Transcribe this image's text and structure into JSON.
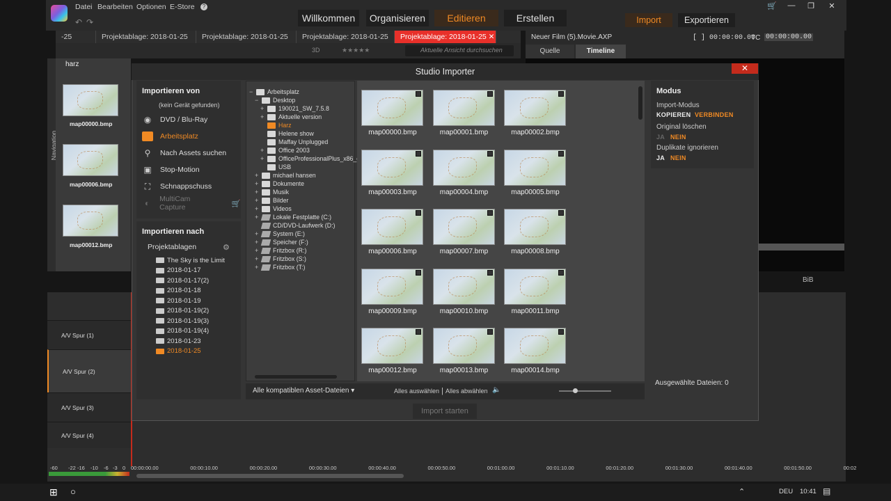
{
  "menu": {
    "file": "Datei",
    "edit": "Bearbeiten",
    "options": "Optionen",
    "estore": "E-Store",
    "help": "?"
  },
  "tabs": {
    "welcome": "Willkommen",
    "organize": "Organisieren",
    "edit": "Editieren",
    "create": "Erstellen",
    "import": "Import",
    "export": "Exportieren"
  },
  "project_tabs": [
    "-25",
    "Projektablage: 2018-01-25",
    "Projektablage: 2018-01-25",
    "Projektablage: 2018-01-25",
    "Projektablage: 2018-01-25"
  ],
  "library": {
    "search_placeholder": "Aktuelle Ansicht durchsuchen",
    "folder": "harz",
    "label_3d": "3D",
    "items": [
      "map00000.bmp",
      "map00006.bmp",
      "map00012.bmp"
    ],
    "nav_label": "Navigation"
  },
  "movie": {
    "title": "Neuer Film (5).Movie.AXP",
    "tc1": "[ ] 00:00:00.00",
    "tc_label": "TC",
    "tc2": "00:00:00.00",
    "tab_source": "Quelle",
    "tab_timeline": "Timeline",
    "bib": "BiB"
  },
  "tracks": [
    "A/V Spur (1)",
    "A/V Spur (2)",
    "A/V Spur (3)",
    "A/V Spur (4)"
  ],
  "ruler": [
    "00:00:00.00",
    "00:00:10.00",
    "00:00:20.00",
    "00:00:30.00",
    "00:00:40.00",
    "00:00:50.00",
    "00:01:00.00",
    "00:01:10.00",
    "00:01:20.00",
    "00:01:30.00",
    "00:01:40.00",
    "00:01:50.00",
    "00:02"
  ],
  "meter": [
    "-60",
    "-22",
    "-16",
    "-10",
    "-6",
    "-3",
    "0"
  ],
  "dialog": {
    "title": "Studio Importer",
    "from_title": "Importieren von",
    "no_device": "(kein Gerät gefunden)",
    "sources": [
      "DVD / Blu-Ray",
      "Arbeitsplatz",
      "Nach Assets suchen",
      "Stop-Motion",
      "Schnappschuss",
      "MultiCam Capture"
    ],
    "to_title": "Importieren nach",
    "bins_label": "Projektablagen",
    "bins": [
      "The Sky is the Limit",
      "2018-01-17",
      "2018-01-17(2)",
      "2018-01-18",
      "2018-01-19",
      "2018-01-19(2)",
      "2018-01-19(3)",
      "2018-01-19(4)",
      "2018-01-23",
      "2018-01-25"
    ],
    "tree": [
      {
        "t": "Arbeitsplatz",
        "lvl": 0,
        "pre": "−"
      },
      {
        "t": "Desktop",
        "lvl": 1,
        "pre": "−"
      },
      {
        "t": "190021_SW_7.5.8",
        "lvl": 2,
        "pre": "+"
      },
      {
        "t": "Aktuelle version",
        "lvl": 2,
        "pre": "+"
      },
      {
        "t": "Harz",
        "lvl": 2,
        "pre": "",
        "sel": true
      },
      {
        "t": "Helene show",
        "lvl": 2,
        "pre": ""
      },
      {
        "t": "Maffay Unplugged",
        "lvl": 2,
        "pre": ""
      },
      {
        "t": "Office 2003",
        "lvl": 2,
        "pre": "+"
      },
      {
        "t": "OfficeProfessionalPlus_x86_d",
        "lvl": 2,
        "pre": "+"
      },
      {
        "t": "USB",
        "lvl": 2,
        "pre": ""
      },
      {
        "t": "michael hansen",
        "lvl": 1,
        "pre": "+"
      },
      {
        "t": "Dokumente",
        "lvl": 1,
        "pre": "+"
      },
      {
        "t": "Musik",
        "lvl": 1,
        "pre": "+"
      },
      {
        "t": "Bilder",
        "lvl": 1,
        "pre": "+"
      },
      {
        "t": "Videos",
        "lvl": 1,
        "pre": "+"
      },
      {
        "t": "Lokale Festplatte (C:)",
        "lvl": 1,
        "pre": "+",
        "drive": true
      },
      {
        "t": "CD/DVD-Laufwerk (D:)",
        "lvl": 1,
        "pre": "",
        "drive": true
      },
      {
        "t": "System (E:)",
        "lvl": 1,
        "pre": "+",
        "drive": true
      },
      {
        "t": "Speicher (F:)",
        "lvl": 1,
        "pre": "+",
        "drive": true
      },
      {
        "t": "Fritzbox (R:)",
        "lvl": 1,
        "pre": "+",
        "drive": true
      },
      {
        "t": "Fritzbox (S:)",
        "lvl": 1,
        "pre": "+",
        "drive": true
      },
      {
        "t": "Fritzbox (T:)",
        "lvl": 1,
        "pre": "+",
        "drive": true
      }
    ],
    "files": [
      "map00000.bmp",
      "map00001.bmp",
      "map00002.bmp",
      "map00003.bmp",
      "map00004.bmp",
      "map00005.bmp",
      "map00006.bmp",
      "map00007.bmp",
      "map00008.bmp",
      "map00009.bmp",
      "map00010.bmp",
      "map00011.bmp",
      "map00012.bmp",
      "map00013.bmp",
      "map00014.bmp"
    ],
    "filter": "Alle kompatiblen Asset-Dateien",
    "select_all": "Alles auswählen",
    "deselect_all": "Alles abwählen",
    "modus_title": "Modus",
    "import_mode": "Import-Modus",
    "copy": "KOPIEREN",
    "link": "VERBINDEN",
    "delete_orig": "Original löschen",
    "yes": "JA",
    "no": "NEIN",
    "ignore_dup": "Duplikate ignorieren",
    "selected": "Ausgewählte Dateien: 0",
    "start": "Import starten"
  },
  "taskbar": {
    "lang": "DEU",
    "time": "10:41"
  },
  "colors": {
    "accent": "#f08a24",
    "active_tab": "#e8302a",
    "close": "#c42b1c"
  }
}
